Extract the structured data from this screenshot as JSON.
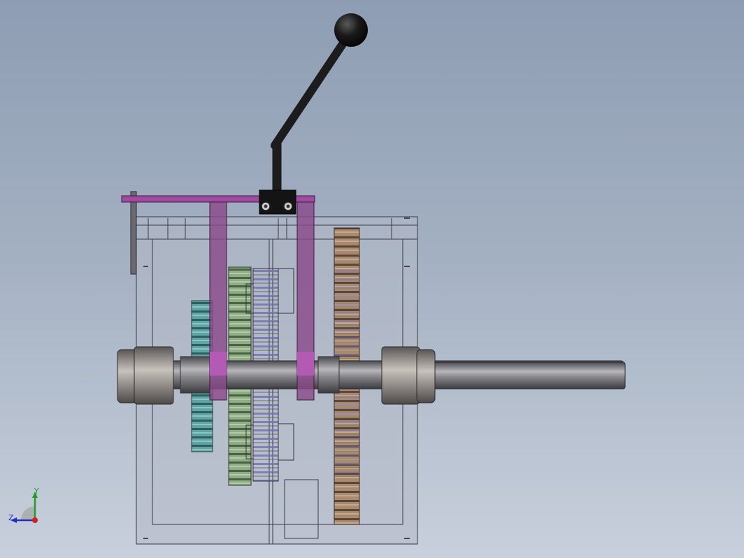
{
  "viewport": {
    "background_top": "#8e9db3",
    "background_bottom": "#c8d0dc"
  },
  "triad": {
    "y_label": "Y",
    "z_label": "Z",
    "y_color": "#20a020",
    "z_color": "#2030c0",
    "x_color": "#d02020"
  },
  "colors": {
    "housing_fill": "#b4bac6",
    "housing_stroke": "#3a3a44",
    "shift_fork": "#8a4a8a",
    "shift_fork_highlight": "#b45ab4",
    "shift_rail": "#a04aa0",
    "lever_handle": "#1c1c1c",
    "shaft": "#6e6e72",
    "gear_teal": "#4e8e8e",
    "gear_green": "#7a9a70",
    "gear_wire": "#6a6aa0",
    "gear_copper": "#9a7860"
  }
}
